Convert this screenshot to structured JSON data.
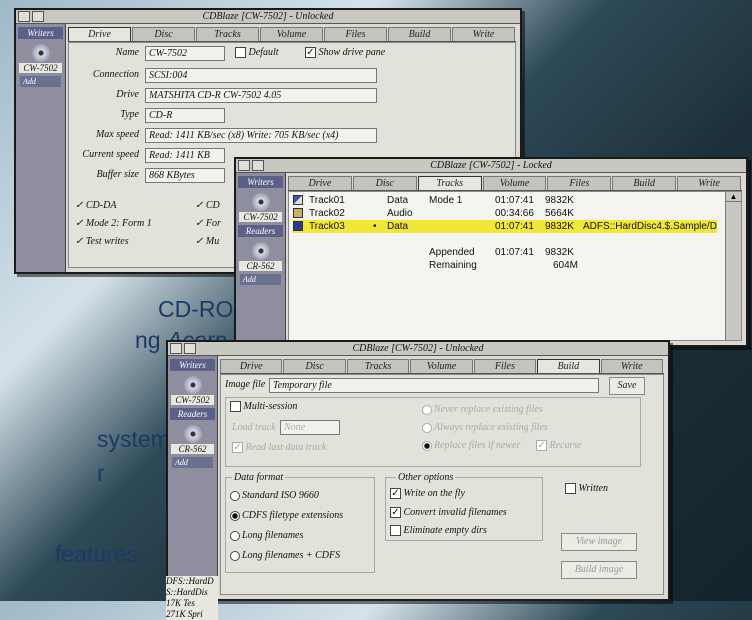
{
  "background_text": [
    "CD-ROM,",
    "ng",
    "Acorn",
    "system",
    "r",
    "features"
  ],
  "sidebar": {
    "writers": "Writers",
    "readers": "Readers",
    "writer_drive": "CW-7502",
    "reader_drive": "CR-562",
    "add": "Add"
  },
  "win1": {
    "title": "CDBlaze [CW-7502] - Unlocked",
    "tabs": [
      "Drive",
      "Disc",
      "Tracks",
      "Volume",
      "Files",
      "Build",
      "Write"
    ],
    "labels": {
      "name": "Name",
      "connection": "Connection",
      "drive": "Drive",
      "type": "Type",
      "max_speed": "Max speed",
      "current_speed": "Current speed",
      "buffer_size": "Buffer size"
    },
    "values": {
      "name": "CW-7502",
      "connection": "SCSI:004",
      "drive": "MATSHITA CD-R  CW-7502 4.05",
      "type": "CD-R",
      "max_speed": "Read: 1411 KB/sec (x8)  Write: 705 KB/sec (x4)",
      "current_speed": "Read: 1411 KB",
      "buffer_size": "868 KBytes"
    },
    "default": "Default",
    "show_drive_pane": "Show drive pane",
    "caps": [
      "CD-DA",
      "Mode 2: Form 1",
      "Test writes"
    ],
    "caps2": [
      "CD",
      "For",
      "Mu"
    ]
  },
  "win2": {
    "title": "CDBlaze [CW-7502] - Locked",
    "tracks": [
      {
        "name": "Track01",
        "type": "Data",
        "mode": "Mode 1",
        "time": "01:07:41",
        "size": "9832K",
        "path": ""
      },
      {
        "name": "Track02",
        "type": "Audio",
        "mode": "",
        "time": "00:34:66",
        "size": "5664K",
        "path": ""
      },
      {
        "name": "Track03",
        "type": "Data",
        "mode": "",
        "time": "01:07:41",
        "size": "9832K",
        "path": "ADFS::HardDisc4.$.Sample/D"
      }
    ],
    "appended_label": "Appended",
    "appended_time": "01:07:41",
    "appended_size": "9832K",
    "remaining_label": "Remaining",
    "remaining_size": "604M"
  },
  "win3": {
    "title": "CDBlaze [CW-7502] - Unlocked",
    "image_file_label": "Image file",
    "image_file_value": "Temporary file",
    "save": "Save",
    "multi_session": "Multi-session",
    "load_track_label": "Load track",
    "load_track_value": "None",
    "read_last": "Read last data track",
    "never_replace": "Never replace existing files",
    "always_replace": "Always replace existing files",
    "replace_if_newer": "Replace files if newer",
    "recurse": "Recurse",
    "data_format": "Data format",
    "formats": [
      "Standard ISO 9660",
      "CDFS filetype extensions",
      "Long filenames",
      "Long filenames + CDFS"
    ],
    "other_options": "Other options",
    "options": [
      "Write on the fly",
      "Convert invalid filenames",
      "Eliminate empty dirs"
    ],
    "written": "Written",
    "view_image": "View image",
    "build_image": "Build image"
  },
  "behind_text": [
    "DFS::HardD",
    "S::HardDis",
    "17K Tes",
    "271K Spri"
  ]
}
